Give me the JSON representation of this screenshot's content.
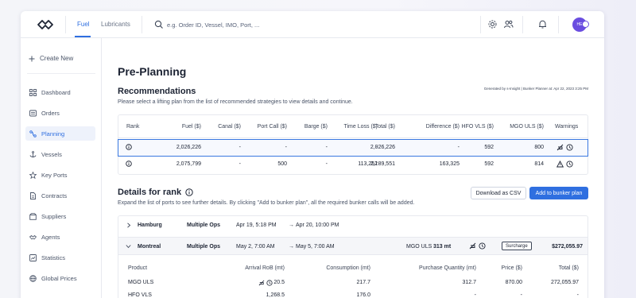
{
  "header": {
    "tabs": [
      "Fuel",
      "Lubricants"
    ],
    "search_placeholder": "e.g. Order ID, Vessel, IMO, Port, ...",
    "avatar_initials": "HE"
  },
  "sidebar": {
    "create_new": "Create New",
    "items": [
      {
        "label": "Dashboard",
        "icon": "grid-icon"
      },
      {
        "label": "Orders",
        "icon": "list-icon"
      },
      {
        "label": "Planning",
        "icon": "route-icon",
        "active": true
      },
      {
        "label": "Vessels",
        "icon": "anchor-icon"
      },
      {
        "label": "Key Ports",
        "icon": "star-icon"
      },
      {
        "label": "Contracts",
        "icon": "document-icon"
      },
      {
        "label": "Suppliers",
        "icon": "box-icon"
      },
      {
        "label": "Agents",
        "icon": "handshake-icon"
      },
      {
        "label": "Statistics",
        "icon": "chart-icon"
      },
      {
        "label": "Global Prices",
        "icon": "globe-icon"
      }
    ]
  },
  "main": {
    "title": "Pre-Planning",
    "recommendations": {
      "title": "Recommendations",
      "generated": "Generated by s-Insight | Bunker Planner at: Apr 22, 2023 3:25 PM",
      "subtitle": "Please select a lifting plan from the list of recommended strategies to view details and continue.",
      "columns": [
        "Rank",
        "Fuel ($)",
        "Canal ($)",
        "Port Call ($)",
        "Barge ($)",
        "Time Loss ($)",
        "Total ($)",
        "Difference ($)",
        "HFO VLS ($)",
        "MGO ULS ($)",
        "Warnings"
      ],
      "rows": [
        {
          "fuel": "2,026,226",
          "canal": "-",
          "port_call": "-",
          "barge": "-",
          "time_loss": "-",
          "total": "2,026,226",
          "difference": "-",
          "hfo": "592",
          "mgo": "800"
        },
        {
          "fuel": "2,075,799",
          "canal": "-",
          "port_call": "500",
          "barge": "-",
          "time_loss": "113,252",
          "total": "2,189,551",
          "difference": "163,325",
          "hfo": "592",
          "mgo": "814"
        }
      ]
    },
    "details": {
      "title": "Details for rank",
      "subtitle": "Expand the list of ports to see further details. By clicking \"Add to bunker plan\", all the required bunker calls will be added.",
      "download_label": "Download as CSV",
      "add_label": "Add to bunker plan",
      "ports": [
        {
          "name": "Hamburg",
          "ops": "Multiple Ops",
          "arrival": "Apr 19, 5:18 PM",
          "departure": "Apr 20, 10:00 PM"
        },
        {
          "name": "Montreal",
          "ops": "Multiple Ops",
          "arrival": "May 2, 7:00 AM",
          "departure": "May 5, 7:00 AM",
          "mgo_label": "MGO ULS",
          "mgo_value": "313 mt",
          "badge": "Surcharge",
          "total": "$272,055.97"
        }
      ],
      "product_columns": [
        "Product",
        "Arrival RoB (mt)",
        "Consumption (mt)",
        "Purchase Quantity (mt)",
        "Price ($)",
        "Total ($)"
      ],
      "products": [
        {
          "product": "MGO ULS",
          "arrival": "20.5",
          "consumption": "217.7",
          "purchase": "312.7",
          "price": "870.00",
          "total": "272,055.97"
        },
        {
          "product": "HFO VLS",
          "arrival": "1,268.5",
          "consumption": "176.0",
          "purchase": "-",
          "price": "-",
          "total": "-"
        }
      ]
    }
  }
}
